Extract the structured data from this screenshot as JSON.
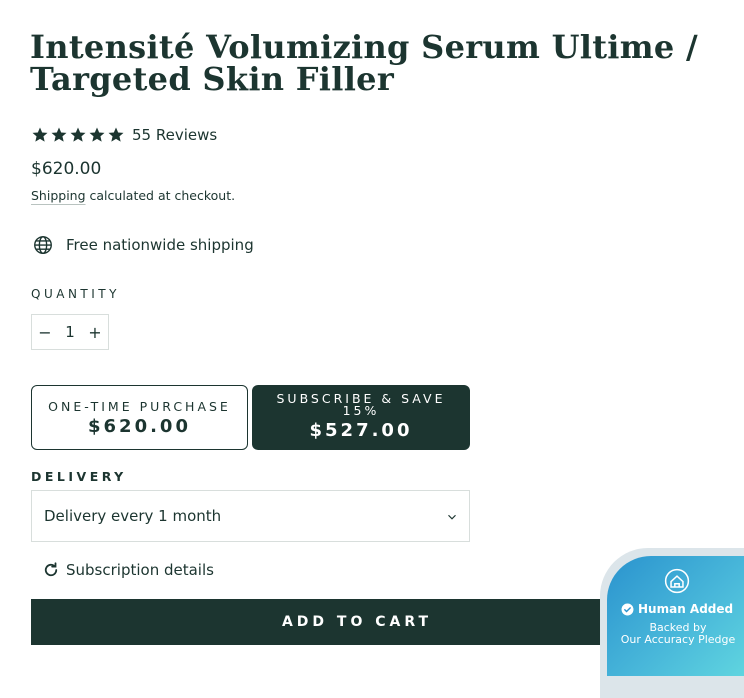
{
  "product": {
    "title": "Intensité Volumizing Serum Ultime / Targeted Skin Filler",
    "rating": 5,
    "reviews_label": "55 Reviews",
    "price": "$620.00",
    "shipping_link": "Shipping",
    "shipping_note": "calculated at checkout.",
    "free_shipping": "Free nationwide shipping"
  },
  "quantity": {
    "label": "QUANTITY",
    "value": "1",
    "minus": "−",
    "plus": "+"
  },
  "purchase_options": {
    "one_time": {
      "label": "ONE-TIME PURCHASE",
      "price": "$620.00"
    },
    "subscribe": {
      "label": "SUBSCRIBE & SAVE 15%",
      "price": "$527.00"
    },
    "selected": "subscribe"
  },
  "delivery": {
    "label": "DELIVERY",
    "selected": "Delivery every 1 month"
  },
  "subscription_details": "Subscription details",
  "add_to_cart": "ADD TO CART",
  "badge": {
    "line1": "Human Added",
    "line2": "Backed by",
    "line3": "Our Accuracy Pledge"
  },
  "colors": {
    "primary": "#1c3530",
    "badge_start": "#2a93ce",
    "badge_end": "#62d8e0"
  },
  "icons": [
    "star-icon",
    "globe-icon",
    "chevron-down-icon",
    "refresh-icon",
    "home-icon",
    "check-circle-icon"
  ]
}
